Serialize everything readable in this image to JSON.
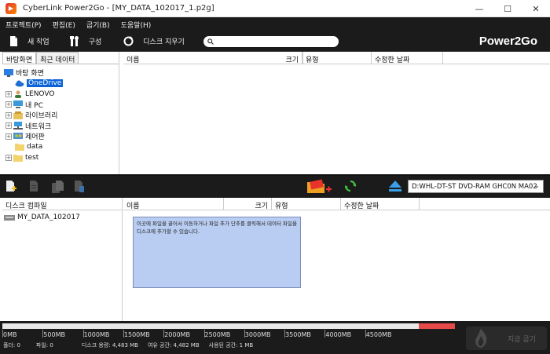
{
  "window": {
    "title": "CyberLink Power2Go - [MY_DATA_102017_1.p2g]",
    "minimize": "—",
    "maximize": "☐",
    "close": "✕"
  },
  "menu": [
    "프로젝트(P)",
    "편집(E)",
    "굽기(B)",
    "도움말(H)"
  ],
  "toolbar": {
    "new_project": "새 작업",
    "settings": "구성",
    "erase_disc": "디스크 지우기",
    "search_placeholder": "",
    "brand": "Power2Go"
  },
  "browser": {
    "tabs": [
      "바탕화면",
      "최근 데이터"
    ],
    "tree": [
      {
        "label": "바탕 화면",
        "icon": "desktop-icon",
        "level": 0,
        "expander": false,
        "selected": false
      },
      {
        "label": "OneDrive",
        "icon": "cloud-icon",
        "level": 1,
        "expander": false,
        "selected": true
      },
      {
        "label": "LENOVO",
        "icon": "user-icon",
        "level": 1,
        "expander": true,
        "selected": false
      },
      {
        "label": "내 PC",
        "icon": "computer-icon",
        "level": 1,
        "expander": true,
        "selected": false
      },
      {
        "label": "라이브러리",
        "icon": "library-icon",
        "level": 1,
        "expander": true,
        "selected": false
      },
      {
        "label": "네트워크",
        "icon": "network-icon",
        "level": 1,
        "expander": true,
        "selected": false
      },
      {
        "label": "제어판",
        "icon": "control-panel-icon",
        "level": 1,
        "expander": true,
        "selected": false
      },
      {
        "label": "data",
        "icon": "folder-icon",
        "level": 1,
        "expander": false,
        "selected": false
      },
      {
        "label": "test",
        "icon": "folder-icon",
        "level": 1,
        "expander": true,
        "selected": false
      }
    ],
    "columns": {
      "name": "이름",
      "size": "크기",
      "type": "유형",
      "modified": "수정한 날짜"
    }
  },
  "drive": {
    "selected": "D:WHL-DT-ST DVD-RAM GHC0N MA02"
  },
  "compilation": {
    "header": "디스크 컴파일",
    "disc_name": "MY_DATA_102017",
    "columns": {
      "name": "이름",
      "size": "크기",
      "type": "유형",
      "modified": "수정한 날짜"
    },
    "hint": "이곳에 파일을 끌어서 이동하거나 파일 추가 단추를 클릭해서 데이터 파일을 디스크에 추가할 수 있습니다."
  },
  "capacity": {
    "ticks": [
      "0MB",
      "500MB",
      "1000MB",
      "1500MB",
      "2000MB",
      "2500MB",
      "3000MB",
      "3500MB",
      "4000MB",
      "4500MB"
    ],
    "used_fraction": 0.0,
    "folders": "폴더: 0",
    "files": "파일: 0",
    "disc_capacity": "디스크 용량: 4,483 MB",
    "free_space": "여유 공간: 4,482 MB",
    "used_space": "사용된 공간: 1 MB",
    "burn_label": "지금 굽기"
  },
  "colors": {
    "accent": "#0a64d8",
    "bar": "#1b1b1b",
    "hint_bg": "#b9cdf2",
    "over_capacity": "#e54a4a"
  }
}
